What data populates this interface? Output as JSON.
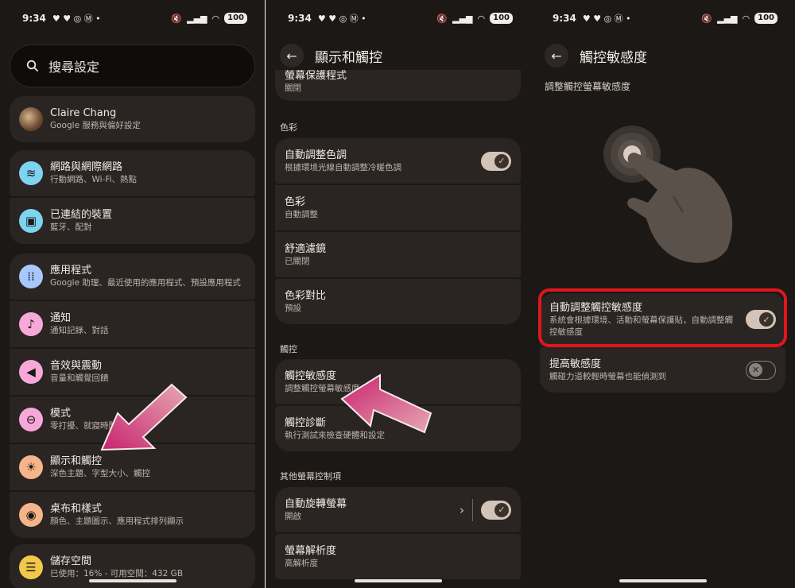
{
  "screen1": {
    "status": {
      "time": "9:34",
      "battery": "100"
    },
    "search_placeholder": "搜尋設定",
    "account": {
      "name": "Claire Chang",
      "sub": "Google 服務與偏好設定"
    },
    "items": [
      {
        "title": "網路與網際網路",
        "sub": "行動網路、Wi-Fi、熱點",
        "icon": "wifi-icon",
        "color": "#7dd3f0",
        "glyph": "≋"
      },
      {
        "title": "已連結的裝置",
        "sub": "藍牙、配對",
        "icon": "devices-icon",
        "color": "#7dd3f0",
        "glyph": "▣"
      },
      {
        "title": "應用程式",
        "sub": "Google 助理、最近使用的應用程式、預設應用程式",
        "icon": "apps-icon",
        "color": "#a9c7ff",
        "glyph": "⁞⁞"
      },
      {
        "title": "通知",
        "sub": "通知記錄、對話",
        "icon": "bell-icon",
        "color": "#f6a8d8",
        "glyph": "🔔"
      },
      {
        "title": "音效與震動",
        "sub": "音量和觸覺回饋",
        "icon": "speaker-icon",
        "color": "#f6a8d8",
        "glyph": "◀"
      },
      {
        "title": "模式",
        "sub": "零打擾、就寢時間",
        "icon": "mode-icon",
        "color": "#f6a8d8",
        "glyph": "⊖"
      },
      {
        "title": "顯示和觸控",
        "sub": "深色主題、字型大小、觸控",
        "icon": "display-icon",
        "color": "#f5b48a",
        "glyph": "☀"
      },
      {
        "title": "桌布和樣式",
        "sub": "顏色、主題圖示、應用程式排列顯示",
        "icon": "palette-icon",
        "color": "#f5b48a",
        "glyph": "◉"
      },
      {
        "title": "儲存空間",
        "sub": "已使用：16% - 可用空間：432 GB",
        "icon": "storage-icon",
        "color": "#f2c84b",
        "glyph": "☰"
      }
    ]
  },
  "screen2": {
    "status": {
      "time": "9:34",
      "battery": "100"
    },
    "title": "顯示和觸控",
    "top_item": {
      "title": "螢幕保護程式",
      "sub": "關閉"
    },
    "color_label": "色彩",
    "color_items": [
      {
        "title": "自動調整色調",
        "sub": "根據環境光線自動調整冷暖色調",
        "toggle": "on"
      },
      {
        "title": "色彩",
        "sub": "自動調整"
      },
      {
        "title": "舒適濾鏡",
        "sub": "已關閉"
      },
      {
        "title": "色彩對比",
        "sub": "預設"
      }
    ],
    "touch_label": "觸控",
    "touch_items": [
      {
        "title": "觸控敏感度",
        "sub": "調整觸控螢幕敏感度"
      },
      {
        "title": "觸控診斷",
        "sub": "執行測試來檢查硬體和設定"
      }
    ],
    "other_label": "其他螢幕控制項",
    "other_items": [
      {
        "title": "自動旋轉螢幕",
        "sub": "開啟",
        "toggle": "on"
      },
      {
        "title": "螢幕解析度",
        "sub": "高解析度"
      }
    ]
  },
  "screen3": {
    "status": {
      "time": "9:34",
      "battery": "100"
    },
    "title": "觸控敏感度",
    "subtitle": "調整觸控螢幕敏感度",
    "items": [
      {
        "title": "自動調整觸控敏感度",
        "sub": "系統會根據環境、活動和螢幕保護貼，自動調整觸控敏感度",
        "toggle": "on"
      },
      {
        "title": "提高敏感度",
        "sub": "觸碰力道較輕時螢幕也能偵測到",
        "toggle": "off"
      }
    ]
  },
  "colors": {
    "highlight": "#e0161b",
    "arrow": "#c8387a"
  }
}
